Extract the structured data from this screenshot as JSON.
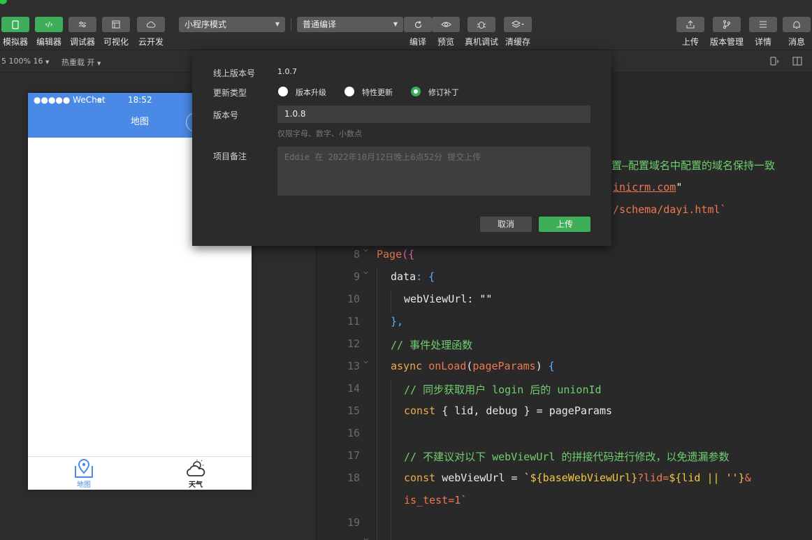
{
  "toolbar": {
    "left_buttons": [
      {
        "label": "模拟器"
      },
      {
        "label": "编辑器"
      },
      {
        "label": "调试器"
      },
      {
        "label": "可视化"
      },
      {
        "label": "云开发"
      }
    ],
    "mode_select": "小程序模式",
    "compile_select": "普通编译",
    "center_buttons": [
      {
        "label": "编译"
      },
      {
        "label": "预览"
      },
      {
        "label": "真机调试"
      },
      {
        "label": "清缓存"
      }
    ],
    "right_buttons": [
      {
        "label": "上传"
      },
      {
        "label": "版本管理"
      },
      {
        "label": "详情"
      },
      {
        "label": "消息"
      }
    ]
  },
  "subbar": {
    "zoom": "5 100% 16",
    "hot_reload": "热重载 开"
  },
  "simulator": {
    "carrier": "●●●●● WeChat",
    "time": "18:52",
    "nav_title": "地图",
    "tabs": [
      {
        "label": "地图",
        "icon": "map-icon",
        "color": "#4a8ae6"
      },
      {
        "label": "天气",
        "icon": "weather-icon",
        "color": "#222222"
      }
    ]
  },
  "editor": {
    "partial_lines": [
      "置—配置域名中配置的域名保持一致",
      "inicrm.com",
      "/schema/dayi.html`"
    ],
    "line_numbers": [
      "8",
      "9",
      "10",
      "11",
      "12",
      "13",
      "14",
      "15",
      "16",
      "17",
      "18",
      "19"
    ],
    "code": {
      "l8_kw": "Page",
      "l8_rest": "({",
      "l9_key": "data",
      "l9_rest": ": {",
      "l10_key": "webViewUrl",
      "l10_rest": ": \"\"",
      "l11": "},",
      "l12": "// 事件处理函数",
      "l13_async": "async",
      "l13_fn": "onLoad",
      "l13_param": "pageParams",
      "l14": "// 同步获取用户 login 后的 unionId",
      "l15_const": "const",
      "l15_rest": "{ lid, debug } = pageParams",
      "l17": "// 不建议对以下 webViewUrl 的拼接代码进行修改，以免遗漏参数",
      "l18_const": "const",
      "l18_var": "webViewUrl = `",
      "l18_tpl": "${baseWebViewUrl}",
      "l18_mid": "?lid=",
      "l18_tpl2": "${lid || ''}",
      "l18_end": "&",
      "l18b": "is_test=1`"
    }
  },
  "modal": {
    "online_version_label": "线上版本号",
    "online_version": "1.0.7",
    "update_type_label": "更新类型",
    "options": [
      "版本升级",
      "特性更新",
      "修订补丁"
    ],
    "selected_option": 2,
    "version_label": "版本号",
    "version_value": "1.0.8",
    "version_hint": "仅限字母、数字、小数点",
    "remark_label": "项目备注",
    "remark_placeholder": "Eddie 在 2022年10月12日晚上6点52分 提交上传",
    "cancel": "取消",
    "upload": "上传"
  },
  "colors": {
    "accent_green": "#3fae5b",
    "nav_blue": "#4a8ae6"
  }
}
